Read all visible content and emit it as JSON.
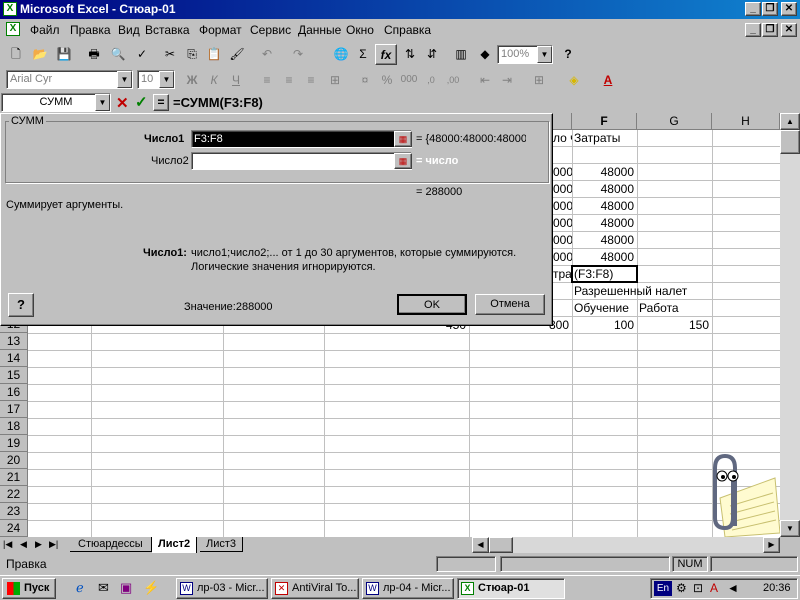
{
  "window": {
    "title": "Microsoft Excel - Стюар-01"
  },
  "menu": {
    "items": [
      "Файл",
      "Правка",
      "Вид",
      "Вставка",
      "Формат",
      "Сервис",
      "Данные",
      "Окно",
      "Справка"
    ]
  },
  "toolbar": {
    "zoom": "100%"
  },
  "format_toolbar": {
    "font": "Arial Cyr",
    "size": "10",
    "bold": "Ж",
    "italic": "К",
    "underline": "Ч"
  },
  "formula_bar": {
    "name_box": "СУММ",
    "formula": "=СУММ(F3:F8)"
  },
  "dialog": {
    "group_title": "СУММ",
    "arg1_label": "Число1",
    "arg1_value": "F3:F8",
    "arg1_result": "= {48000:48000:48000",
    "arg2_label": "Число2",
    "arg2_value": "",
    "arg2_result": "= число",
    "total": "= 288000",
    "description": "Суммирует аргументы.",
    "help_label": "Число1:",
    "help_text1": "число1;число2;... от 1 до 30 аргументов, которые суммируются.",
    "help_text2": "Логические значения игнорируются.",
    "value_text": "Значение:288000",
    "ok": "OK",
    "cancel": "Отмена"
  },
  "grid": {
    "columns": [
      "F",
      "G",
      "H"
    ],
    "rows": [
      "12",
      "13",
      "14",
      "15",
      "16",
      "17",
      "18",
      "19",
      "20",
      "21",
      "22",
      "23",
      "24"
    ],
    "e_header": "ло ч",
    "f_header": "Затраты",
    "f_values": [
      "48000",
      "48000",
      "48000",
      "48000",
      "48000",
      "48000"
    ],
    "e_values": [
      "000",
      "000",
      "000",
      "000",
      "000",
      "000"
    ],
    "e9": "трат",
    "f9": "(F3:F8)",
    "f10": "Разрешенный налет",
    "f11": "Обучение",
    "g11": "Работа",
    "d12": "450",
    "e12": "800",
    "f12": "100",
    "g12": "150"
  },
  "sheets": [
    "Стюардессы",
    "Лист2",
    "Лист3"
  ],
  "status": {
    "left": "Правка",
    "num": "NUM"
  },
  "taskbar": {
    "start": "Пуск",
    "tasks": [
      "лр-03 - Micr...",
      "AntiViral To...",
      "лр-04 - Micr...",
      "Стюар-01"
    ],
    "lang": "En",
    "clock": "20:36"
  }
}
